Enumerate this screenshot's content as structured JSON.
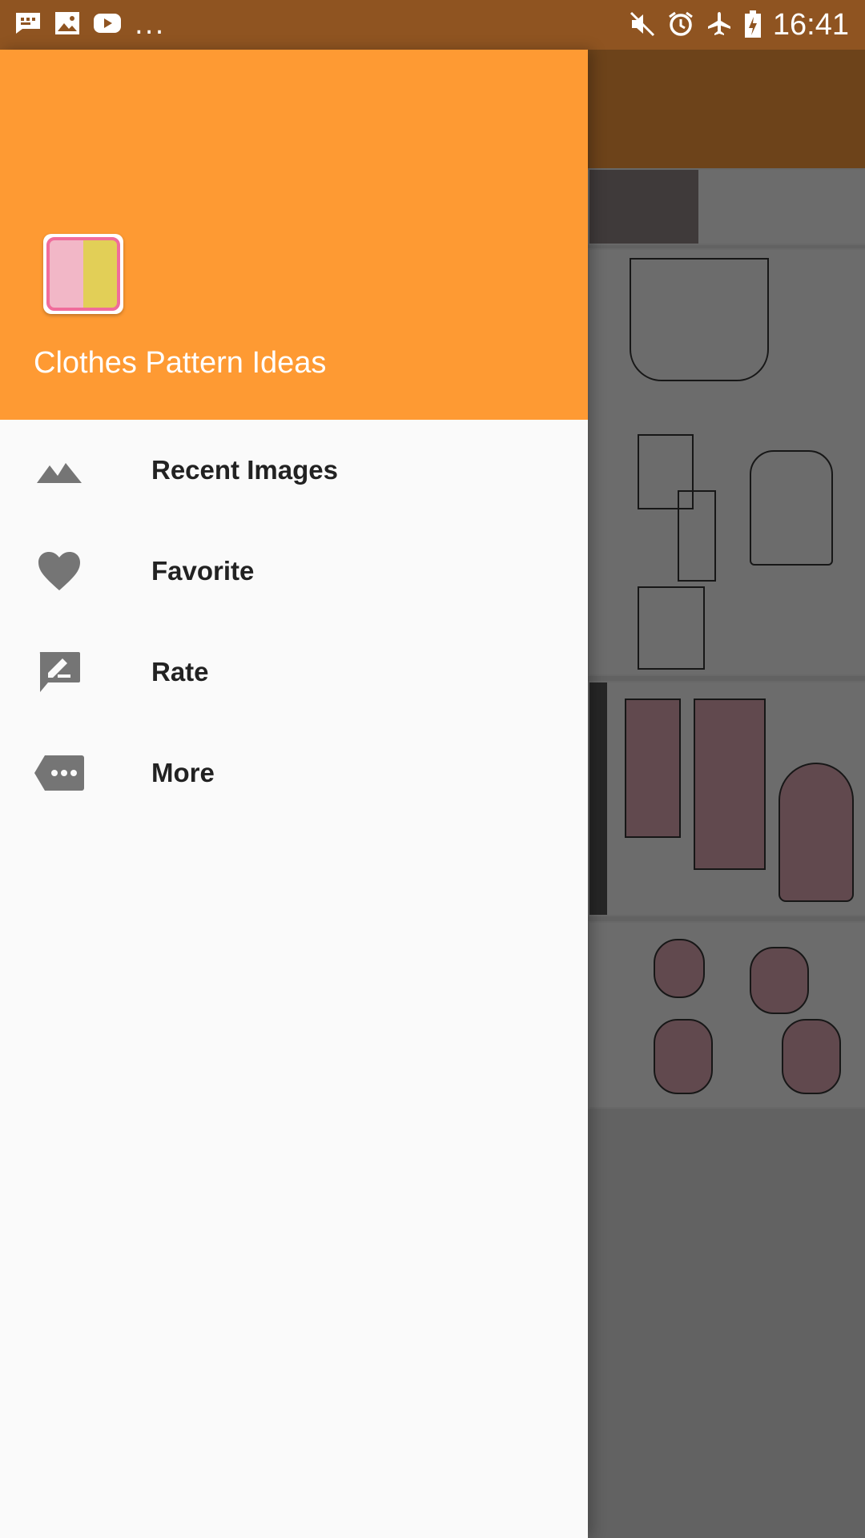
{
  "status_bar": {
    "time": "16:41",
    "more_indicator": "...",
    "left_icons": [
      "message-icon",
      "image-icon",
      "youtube-icon"
    ],
    "right_icons": [
      "mute-icon",
      "alarm-icon",
      "airplane-mode-icon",
      "battery-charging-icon"
    ]
  },
  "drawer": {
    "app_title": "Clothes Pattern Ideas",
    "items": [
      {
        "label": "Recent Images",
        "icon": "landscape-icon"
      },
      {
        "label": "Favorite",
        "icon": "heart-icon"
      },
      {
        "label": "Rate",
        "icon": "rate-review-icon"
      },
      {
        "label": "More",
        "icon": "more-tag-icon"
      }
    ]
  },
  "colors": {
    "status_bar": "#8f5421",
    "header": "#fe9a33",
    "drawer_bg": "#fafafa",
    "icon_gray": "#757575",
    "label": "#222222"
  }
}
